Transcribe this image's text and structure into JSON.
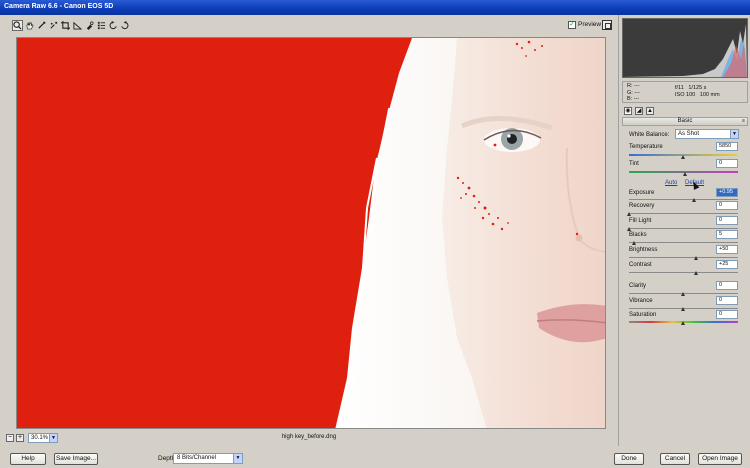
{
  "window": {
    "title": "Camera Raw 6.6  -  Canon EOS 5D"
  },
  "toolbar": {
    "tools": [
      "zoom-icon",
      "hand-icon",
      "eyedropper-icon",
      "crop-icon",
      "straighten-icon",
      "retouch-icon",
      "list-icon",
      "rotate-left-icon",
      "rotate-right-icon"
    ],
    "preview_label": "Preview",
    "preview_checked": true
  },
  "status": {
    "zoom_value": "30.1%",
    "filename": "high key_before.dng"
  },
  "panel": {
    "readout": {
      "r": "R:  ---",
      "g": "G:  ---",
      "b": "B:  ---",
      "aperture": "f/11",
      "shutter": "1/125 s",
      "iso": "ISO 100",
      "focal": "100 mm"
    },
    "section_title": "Basic",
    "white_balance_label": "White Balance:",
    "white_balance_value": "As Shot",
    "auto_label": "Auto",
    "default_label": "Default",
    "controls": {
      "temperature": {
        "label": "Temperature",
        "value": "5850",
        "level": 0.5
      },
      "tint": {
        "label": "Tint",
        "value": "0",
        "level": 0.52
      },
      "exposure": {
        "label": "Exposure",
        "value": "+0.95",
        "level": 0.6
      },
      "recovery": {
        "label": "Recovery",
        "value": "0",
        "level": 0.0
      },
      "fill_light": {
        "label": "Fill Light",
        "value": "0",
        "level": 0.0
      },
      "blacks": {
        "label": "Blacks",
        "value": "5",
        "level": 0.05
      },
      "brightness": {
        "label": "Brightness",
        "value": "+50",
        "level": 0.62
      },
      "contrast": {
        "label": "Contrast",
        "value": "+25",
        "level": 0.62
      },
      "clarity": {
        "label": "Clarity",
        "value": "0",
        "level": 0.5
      },
      "vibrance": {
        "label": "Vibrance",
        "value": "0",
        "level": 0.5
      },
      "saturation": {
        "label": "Saturation",
        "value": "0",
        "level": 0.5
      }
    }
  },
  "buttons": {
    "help": "Help",
    "save_image": "Save Image...",
    "depth_label": "Depth:",
    "depth_value": "8 Bits/Channel",
    "done": "Done",
    "cancel": "Cancel",
    "open_image": "Open Image"
  },
  "colors": {
    "clipping_warning": "#e0200f",
    "titlebar": "#0b3cb5"
  }
}
